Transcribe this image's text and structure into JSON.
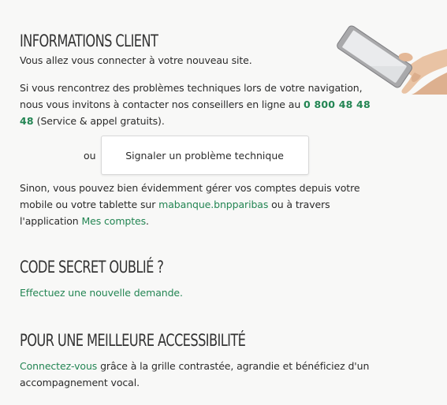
{
  "info": {
    "title": "INFORMATIONS CLIENT",
    "connect_text": "Vous allez vous connecter à votre nouveau site.",
    "problems_text": "Si vous rencontrez des problèmes techniques lors de votre navigation, nous vous invitons à contacter nos conseillers en ligne au",
    "phone_number": "0 800 48 48 48",
    "phone_note": "(Service & appel gratuits).",
    "or_label": "ou",
    "report_button_label": "Signaler un problème technique",
    "otherwise_text_1": "Sinon, vous pouvez bien évidemment gérer vos comptes depuis votre mobile ou votre tablette sur",
    "site_link": "mabanque.bnpparibas",
    "otherwise_text_2": "ou à travers l'application",
    "app_link": "Mes comptes",
    "period": "."
  },
  "secret_code": {
    "title": "CODE SECRET OUBLIÉ ?",
    "request_link": "Effectuez une nouvelle demande."
  },
  "accessibility": {
    "title": "POUR UNE MEILLEURE ACCESSIBILITÉ",
    "connect_link": "Connectez-vous",
    "description": "grâce à la grille contrastée, agrandie et bénéficiez d'un accompagnement vocal."
  },
  "colors": {
    "link_green": "#238553",
    "background": "#f8f8f7"
  }
}
